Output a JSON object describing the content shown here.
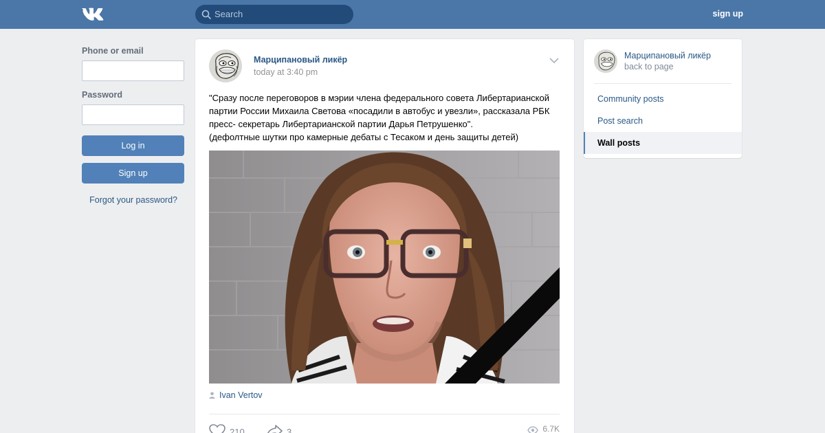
{
  "header": {
    "search_placeholder": "Search",
    "signup_label": "sign up",
    "logo_icon": "vk-logo-icon",
    "search_icon": "search-icon",
    "background_color": "#4a76a8"
  },
  "login": {
    "email_label": "Phone or email",
    "email_value": "",
    "password_label": "Password",
    "password_value": "",
    "login_button": "Log in",
    "signup_button": "Sign up",
    "forgot_link": "Forgot your password?"
  },
  "post": {
    "author": "Марципановый ликёр",
    "time": "today at 3:40 pm",
    "text_lines": [
      "\"Сразу после переговоров в мэрии члена федерального совета Либертарианской",
      "партии России Михаила Светова «посадили в автобус и увезли», рассказала РБК",
      "пресс- секретарь Либертарианской партии Дарья Петрушенко\".",
      "(дефолтные шутки про камерные дебаты с Тесаком и день защиты детей)"
    ],
    "photo_icon": "portrait-photo",
    "signer": "Ivan Vertov",
    "likes": "210",
    "shares": "3",
    "views": "6.7K"
  },
  "sidebar": {
    "name": "Марципановый ликёр",
    "back": "back to page",
    "items": [
      {
        "label": "Community posts"
      },
      {
        "label": "Post search"
      },
      {
        "label": "Wall posts",
        "active": true
      }
    ]
  },
  "colors": {
    "accent": "#5181b8",
    "link": "#2a5885",
    "page_bg": "#edeef0"
  }
}
